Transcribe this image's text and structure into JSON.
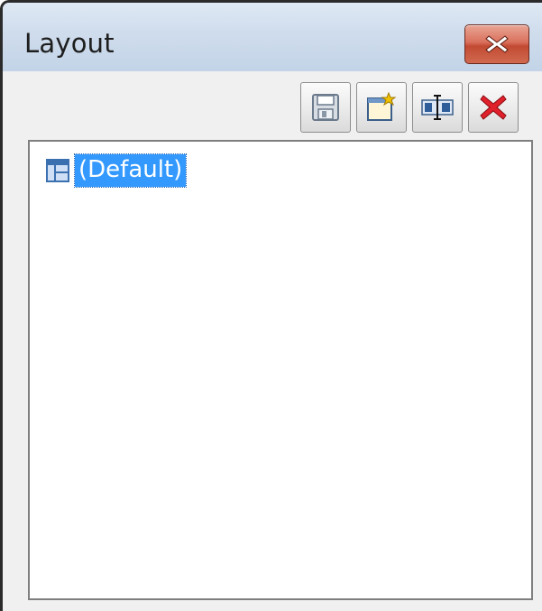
{
  "window": {
    "title": "Layout"
  },
  "toolbar": {
    "buttons": [
      {
        "icon": "save-icon"
      },
      {
        "icon": "new-layout-icon"
      },
      {
        "icon": "rename-icon"
      },
      {
        "icon": "delete-icon"
      }
    ]
  },
  "tree": {
    "items": [
      {
        "label": "(Default)",
        "icon": "layout-grid-icon",
        "selected": true
      }
    ]
  },
  "colors": {
    "selection": "#3399ff",
    "close_button": "#c24a32",
    "delete_red": "#e0202a"
  }
}
